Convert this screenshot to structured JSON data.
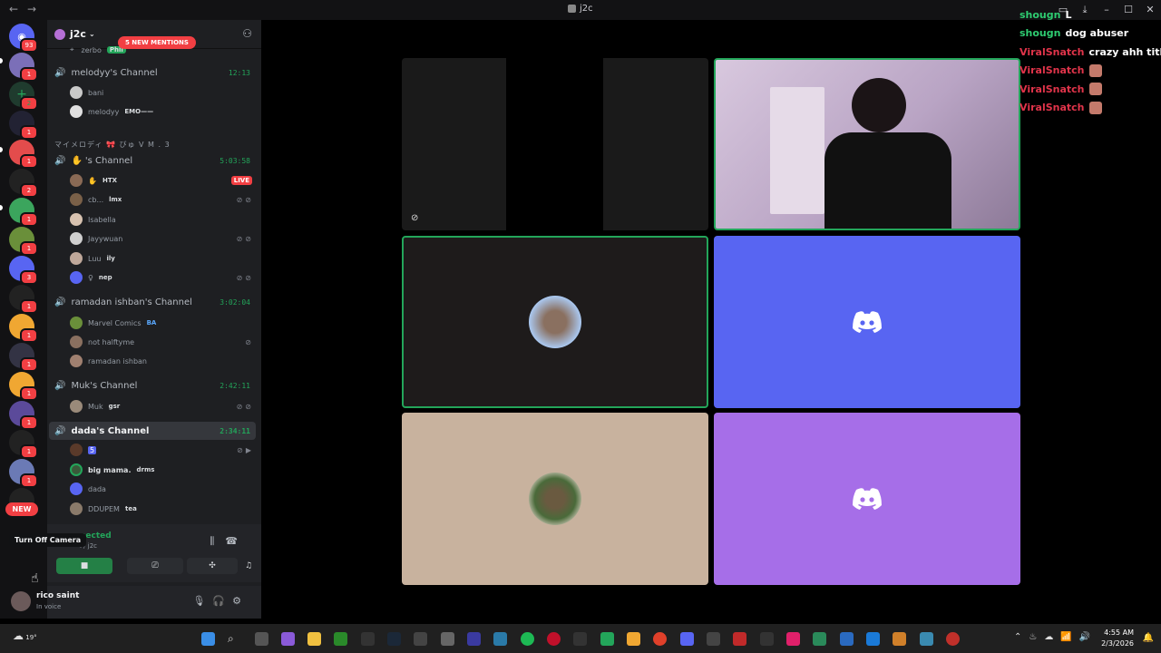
{
  "window": {
    "title": "j2c"
  },
  "server": {
    "name": "j2c"
  },
  "rail": {
    "home_badge": "93",
    "new_label": "NEW"
  },
  "sidebar": {
    "mentions_banner": "5 NEW MENTIONS",
    "top_member": {
      "name": "zerbo",
      "tag": "Phil"
    },
    "channels": {
      "melodyy": {
        "name": "melodyy's Channel",
        "timer": "12:13",
        "members": [
          {
            "name": "bani",
            "tag": ""
          },
          {
            "name": "melodyy",
            "tag": "EMO——"
          }
        ]
      },
      "category": "マイメロディ 🎀 びゅ V M . 3",
      "hand": {
        "name": "'s Channel",
        "timer": "5:03:58",
        "members": [
          {
            "name": "",
            "tag": "HTX",
            "live": "LIVE"
          },
          {
            "name": "cb...",
            "tag": "lmx"
          },
          {
            "name": "Isabella",
            "tag": ""
          },
          {
            "name": "Jayywuan",
            "tag": ""
          },
          {
            "name": "Luu",
            "tag": "ily"
          },
          {
            "name": "",
            "tag": "nep"
          }
        ]
      },
      "ramadan": {
        "name": "ramadan ishban's Channel",
        "timer": "3:02:04",
        "members": [
          {
            "name": "Marvel Comics",
            "tag": "BA"
          },
          {
            "name": "not halftyme",
            "tag": ""
          },
          {
            "name": "ramadan ishban",
            "tag": ""
          }
        ]
      },
      "muk": {
        "name": "Muk's Channel",
        "timer": "2:42:11",
        "members": [
          {
            "name": "Muk",
            "tag": "gsr"
          }
        ]
      },
      "dada": {
        "name": "dada's Channel",
        "timer": "2:34:11",
        "members": [
          {
            "name": "5",
            "tag": ""
          },
          {
            "name": "big mama.",
            "tag": "drms"
          },
          {
            "name": "dada",
            "tag": ""
          },
          {
            "name": "DDUPEM",
            "tag": "tea"
          }
        ]
      }
    }
  },
  "voice": {
    "status": "nected",
    "location": "l / j2c",
    "tooltip": "Turn Off Camera"
  },
  "user": {
    "name": "rico saint",
    "status": "In voice"
  },
  "chat": [
    {
      "user": "shougn",
      "msg": "L",
      "color": "#2ecc71"
    },
    {
      "user": "shougn",
      "msg": "dog abuser",
      "color": "#2ecc71"
    },
    {
      "user": "ViralSnatch",
      "msg": "crazy ahh title",
      "color": "#e0344a"
    },
    {
      "user": "ViralSnatch",
      "msg": "",
      "color": "#e0344a"
    },
    {
      "user": "ViralSnatch",
      "msg": "",
      "color": "#e0344a"
    },
    {
      "user": "ViralSnatch",
      "msg": "",
      "color": "#e0344a"
    }
  ],
  "taskbar": {
    "weather": "19°",
    "time": "4:55 AM",
    "date": "2/3/2026"
  },
  "colors": {
    "discord_blurple": "#5865f2",
    "tile_purple": "#a66ee8",
    "tile_beige": "#c8b29e",
    "speaking_green": "#23a55a"
  }
}
